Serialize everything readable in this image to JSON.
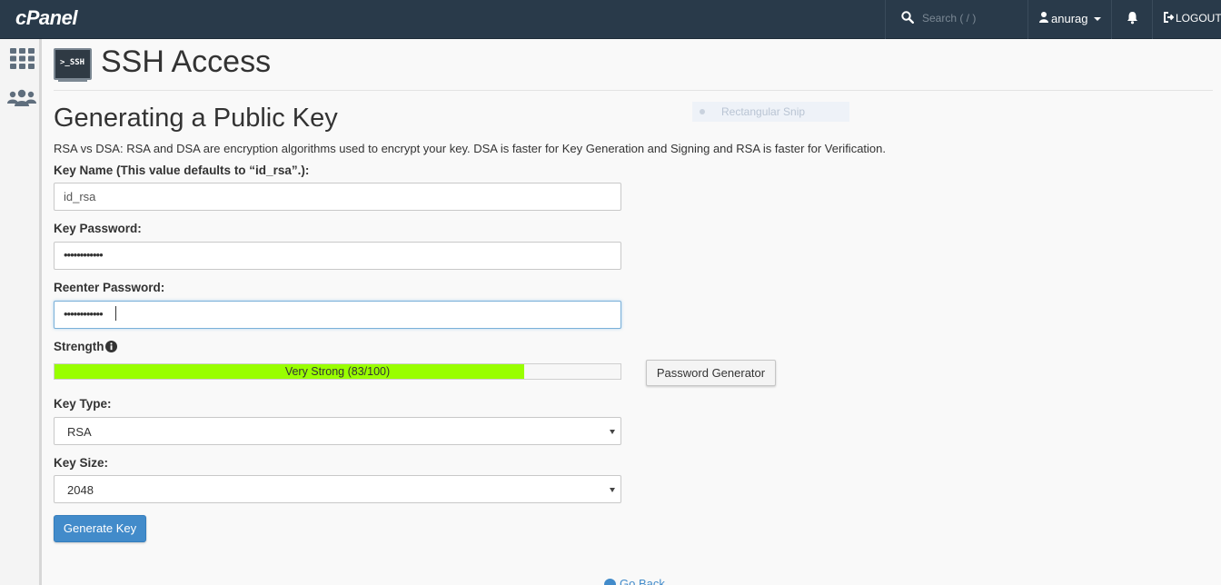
{
  "navbar": {
    "logo": "cPanel",
    "search_placeholder": "Search ( / )",
    "username": "anurag",
    "logout": "LOGOUT"
  },
  "sidebar": {
    "icons": [
      "grid-icon",
      "users-icon"
    ]
  },
  "page": {
    "title": "SSH Access",
    "icon_text": ">_SSH"
  },
  "overlay": {
    "snip_text": "Rectangular Snip"
  },
  "form": {
    "section_title": "Generating a Public Key",
    "description": "RSA vs DSA: RSA and DSA are encryption algorithms used to encrypt your key. DSA is faster for Key Generation and Signing and RSA is faster for Verification.",
    "key_name_label": "Key Name (This value defaults to “id_rsa”.):",
    "key_name_value": "id_rsa",
    "key_password_label": "Key Password:",
    "key_password_value": "••••••••••••",
    "reenter_label": "Reenter Password:",
    "reenter_value": "••••••••••••",
    "strength_label": "Strength",
    "strength_text": "Very Strong (83/100)",
    "strength_value": 83,
    "strength_max": 100,
    "password_generator": "Password Generator",
    "key_type_label": "Key Type:",
    "key_type_value": "RSA",
    "key_size_label": "Key Size:",
    "key_size_value": "2048",
    "generate_button": "Generate Key",
    "go_back": "Go Back"
  },
  "colors": {
    "navbar": "#293a4a",
    "strength_fill": "#99ff00",
    "primary": "#428bca"
  }
}
